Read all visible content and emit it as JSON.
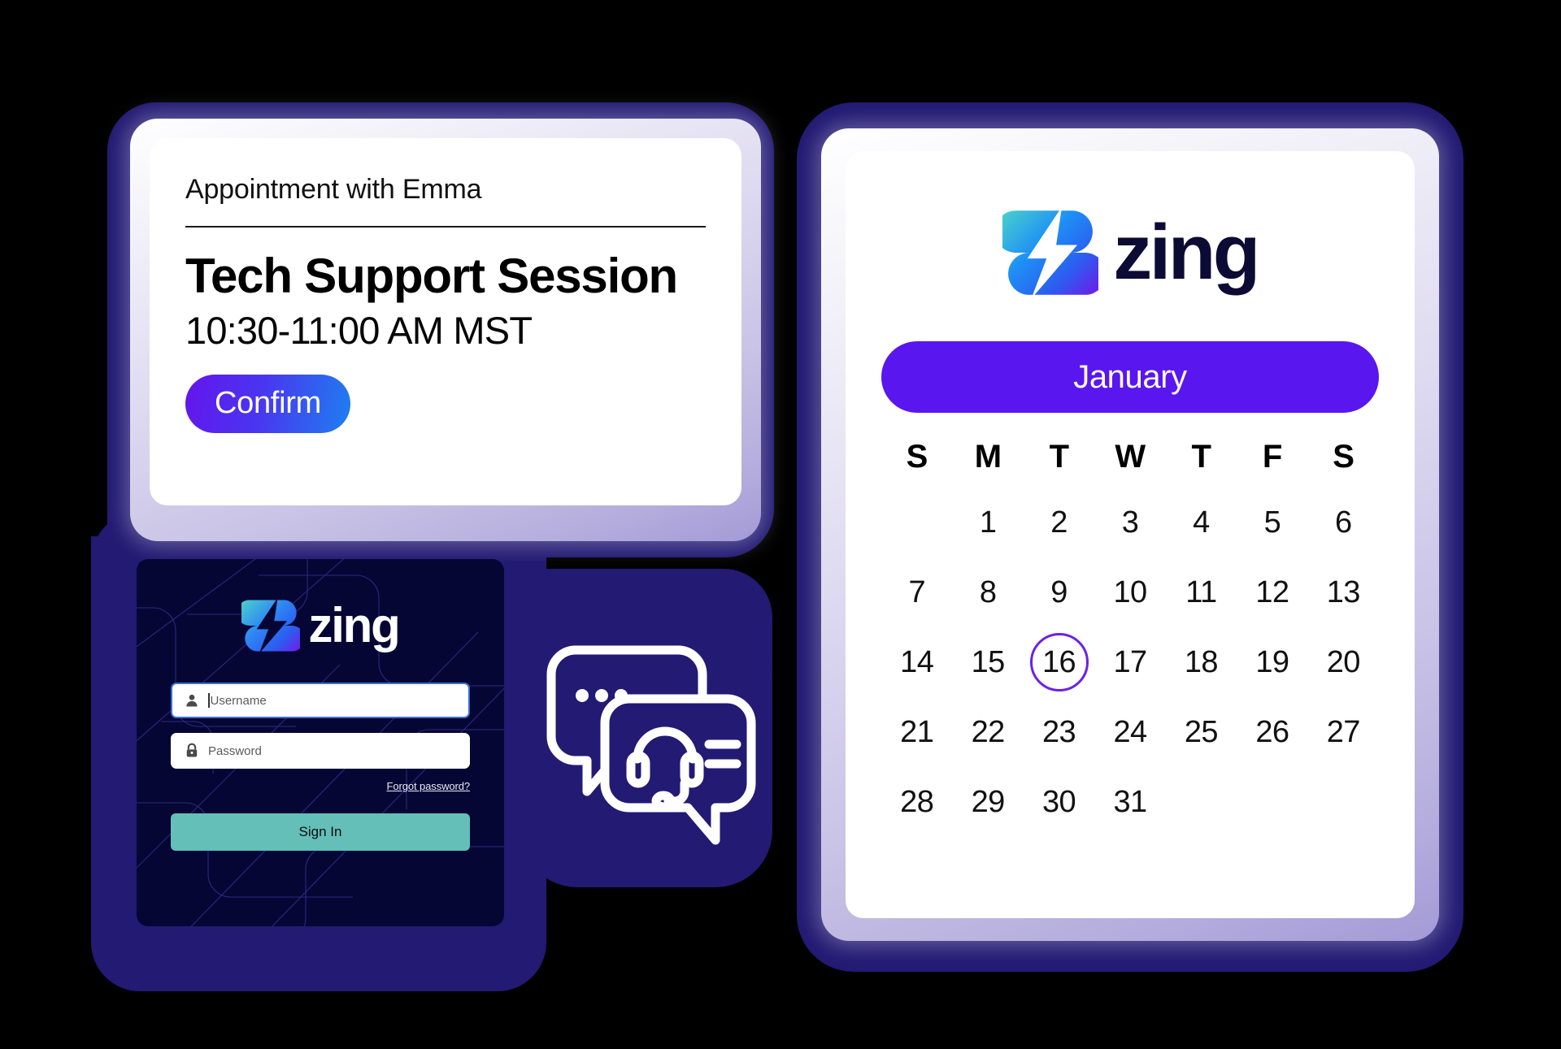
{
  "theme": {
    "navy_backdrop": "#221A73",
    "login_card_bg": "#060635",
    "accent_purple": "#5916EE",
    "accent_teal": "#63BFB7",
    "confirm_gradient_from": "#6415EC",
    "confirm_gradient_to": "#1E7FF0",
    "selected_day_ring": "#6B21E8",
    "logo_gradient_teal": "#4DD6C8",
    "logo_gradient_blue": "#1E7FF0",
    "logo_gradient_purple": "#7A12E8"
  },
  "appointment": {
    "subtitle": "Appointment with Emma",
    "title": "Tech Support Session",
    "time": "10:30-11:00 AM MST",
    "confirm_label": "Confirm"
  },
  "login": {
    "wordmark": "zing",
    "logo_icon": "zing-bolt-logo-icon",
    "username": {
      "icon": "person-icon",
      "placeholder": "Username",
      "value": ""
    },
    "password": {
      "icon": "lock-icon",
      "placeholder": "Password",
      "value": ""
    },
    "forgot_label": "Forgot password?",
    "signin_label": "Sign In"
  },
  "chat": {
    "icon": "support-chat-bubbles-icon"
  },
  "calendar": {
    "wordmark": "zing",
    "logo_icon": "zing-bolt-logo-icon",
    "month": "January",
    "weekdays": [
      "S",
      "M",
      "T",
      "W",
      "T",
      "F",
      "S"
    ],
    "leading_blanks": 1,
    "days": [
      1,
      2,
      3,
      4,
      5,
      6,
      7,
      8,
      9,
      10,
      11,
      12,
      13,
      14,
      15,
      16,
      17,
      18,
      19,
      20,
      21,
      22,
      23,
      24,
      25,
      26,
      27,
      28,
      29,
      30,
      31
    ],
    "selected_day": 16
  }
}
